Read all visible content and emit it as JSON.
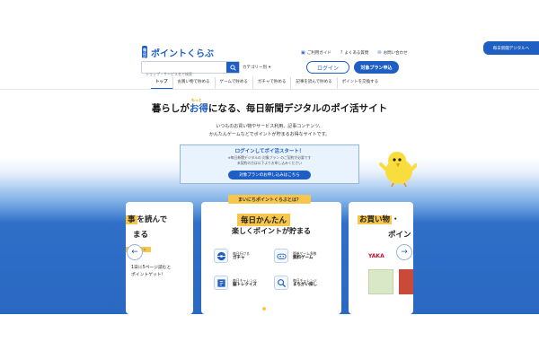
{
  "header": {
    "logo_mark": "毎日新聞",
    "logo_text": "ポイントくらぶ",
    "search_placeholder": "ショップ・サービス名で検索",
    "category_label": "カテゴリー別",
    "links": [
      "ご利用ガイド",
      "よくある質問",
      "お問い合わせ"
    ],
    "login_label": "ログイン",
    "plan_label": "対象プラン申込",
    "digital_label": "毎日新聞デジタルへ"
  },
  "nav": {
    "items": [
      "トップ",
      "お買い物で貯める",
      "ゲームで貯める",
      "ガチャで貯める",
      "記事を読んで貯める",
      "ポイントを交換する"
    ]
  },
  "hero": {
    "title_pre": "暮らしが",
    "title_hl": "お得",
    "title_post": "になる、毎日新聞デジタルのポイ活サイト",
    "motto": "もっと",
    "sub_line1": "いつものお買い物やサービス利用、記事コンテンツ、",
    "sub_line2": "かんたんゲームなどでポイントが貯まるお得なサイトです。"
  },
  "login_box": {
    "title": "ログインしてポイ活スタート！",
    "note1": "※毎日新聞デジタルの 対象プラン のご契約が必要です",
    "note2": "未契約の方は以下よりお申し込みください",
    "cta": "対象プランのお申し込みはこちら"
  },
  "carousel": {
    "ribbon": "まいにちポイントくらぶとは？",
    "left_card": {
      "title_tag": "事",
      "title_rest": "を読んで",
      "sub": "まる",
      "badge": "ミッション",
      "note1": "1日に5ページ読むと",
      "note2": "ポイントゲット！"
    },
    "mid_card": {
      "title": "毎日かんたん",
      "sub": "楽しくポイントが貯まる",
      "features": [
        {
          "small": "毎日行ける",
          "big": "ガチャ"
        },
        {
          "small": "簡単ゲーム多数",
          "big": "無料ゲーム"
        },
        {
          "small": "毎日チャレンジ",
          "big": "脳トレクイズ"
        },
        {
          "small": "毎日チャレンジ",
          "big": "まちがい探し"
        }
      ]
    },
    "right_card": {
      "title_tag": "お買い物",
      "title_rest": "・",
      "sub": "ポイン",
      "brand": "YAKA"
    },
    "dots_total": 4,
    "dots_active": 2
  },
  "icons": {
    "search": "search-icon",
    "arrow_left": "arrow-left-icon",
    "arrow_right": "arrow-right-icon"
  },
  "colors": {
    "brand": "#1f5fc4",
    "accent": "#f7c64a"
  }
}
